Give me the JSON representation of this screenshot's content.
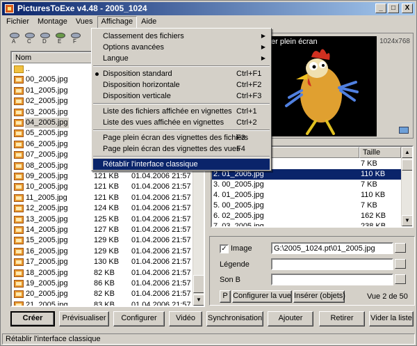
{
  "window": {
    "title": "PicturesToExe v4.48 - 2005_1024"
  },
  "title_buttons": {
    "minimize": "_",
    "maximize": "□",
    "close": "X"
  },
  "menubar": [
    "Fichier",
    "Montage",
    "Vues",
    "Affichage",
    "Aide"
  ],
  "toolbar": {
    "drives": [
      "A",
      "C",
      "D",
      "E",
      "F"
    ]
  },
  "file_list": {
    "column_header": "Nom",
    "parent": "..",
    "rows": [
      {
        "name": "00_2005.jpg",
        "size": "",
        "date": ""
      },
      {
        "name": "01_2005.jpg",
        "size": "",
        "date": ""
      },
      {
        "name": "02_2005.jpg",
        "size": "",
        "date": ""
      },
      {
        "name": "03_2005.jpg",
        "size": "",
        "date": ""
      },
      {
        "name": "04_2005.jpg",
        "size": "",
        "date": ""
      },
      {
        "name": "05_2005.jpg",
        "size": "",
        "date": ""
      },
      {
        "name": "06_2005.jpg",
        "size": "",
        "date": ""
      },
      {
        "name": "07_2005.jpg",
        "size": "",
        "date": ""
      },
      {
        "name": "08_2005.jpg",
        "size": "",
        "date": ""
      },
      {
        "name": "09_2005.jpg",
        "size": "121 KB",
        "date": "01.04.2006  21:57"
      },
      {
        "name": "10_2005.jpg",
        "size": "121 KB",
        "date": "01.04.2006  21:57"
      },
      {
        "name": "11_2005.jpg",
        "size": "121 KB",
        "date": "01.04.2006  21:57"
      },
      {
        "name": "12_2005.jpg",
        "size": "124 KB",
        "date": "01.04.2006  21:57"
      },
      {
        "name": "13_2005.jpg",
        "size": "125 KB",
        "date": "01.04.2006  21:57"
      },
      {
        "name": "14_2005.jpg",
        "size": "127 KB",
        "date": "01.04.2006  21:57"
      },
      {
        "name": "15_2005.jpg",
        "size": "129 KB",
        "date": "01.04.2006  21:57"
      },
      {
        "name": "16_2005.jpg",
        "size": "129 KB",
        "date": "01.04.2006  21:57"
      },
      {
        "name": "17_2005.jpg",
        "size": "130 KB",
        "date": "01.04.2006  21:57"
      },
      {
        "name": "18_2005.jpg",
        "size": "82 KB",
        "date": "01.04.2006  21:57"
      },
      {
        "name": "19_2005.jpg",
        "size": "86 KB",
        "date": "01.04.2006  21:57"
      },
      {
        "name": "20_2005.jpg",
        "size": "82 KB",
        "date": "01.04.2006  21:57"
      },
      {
        "name": "21_2005.jpg",
        "size": "83 KB",
        "date": "01.04.2006  21:57"
      }
    ],
    "selected_index": 4
  },
  "preview": {
    "label": "er plein écran",
    "resolution": "1024x768"
  },
  "slide_list": {
    "header": "Taille",
    "rows": [
      {
        "name": "",
        "size": "7 KB"
      },
      {
        "name": "2. 01_2005.jpg",
        "size": "110 KB"
      },
      {
        "name": "3. 00_2005.jpg",
        "size": "7 KB"
      },
      {
        "name": "4. 01_2005.jpg",
        "size": "110 KB"
      },
      {
        "name": "5. 00_2005.jpg",
        "size": "7 KB"
      },
      {
        "name": "6. 02_2005.jpg",
        "size": "162 KB"
      },
      {
        "name": "7. 03_2005.jpg",
        "size": "238 KB"
      }
    ],
    "selected_index": 1
  },
  "props": {
    "image_label": "Image",
    "image_value": "G:\\2005_1024.pt\\01_2005.jpg",
    "legend_label": "Légende",
    "legend_value": "",
    "sound_label": "Son B",
    "sound_value": "",
    "p_button": "P",
    "configure_view": "Configurer la vue",
    "insert_objects": "Insérer (objets)",
    "view_count": "Vue 2 de 50"
  },
  "buttons": {
    "create": "Créer",
    "preview": "Prévisualiser",
    "configure": "Configurer",
    "video": "Vidéo",
    "sync": "Synchronisation",
    "add": "Ajouter",
    "remove": "Retirer",
    "clear": "Vider la liste"
  },
  "dropdown": {
    "items": [
      {
        "label": "Classement des fichiers",
        "accel": "",
        "submenu": true
      },
      {
        "label": "Options avancées",
        "accel": "",
        "submenu": true
      },
      {
        "label": "Langue",
        "accel": "",
        "submenu": true
      },
      {
        "label": "Disposition standard",
        "accel": "Ctrl+F1",
        "checked": true
      },
      {
        "label": "Disposition horizontale",
        "accel": "Ctrl+F2"
      },
      {
        "label": "Disposition verticale",
        "accel": "Ctrl+F3"
      },
      {
        "label": "Liste des fichiers affichée en vignettes",
        "accel": "Ctrl+1"
      },
      {
        "label": "Liste des vues affichée en vignettes",
        "accel": "Ctrl+2"
      },
      {
        "label": "Page plein écran des vignettes des fichiers",
        "accel": "F3"
      },
      {
        "label": "Page plein écran des vignettes des vues",
        "accel": "F4"
      },
      {
        "label": "Rétablir l'interface classique",
        "accel": "",
        "highlighted": true
      }
    ]
  },
  "status": {
    "text": "Rétablir l'interface classique"
  }
}
